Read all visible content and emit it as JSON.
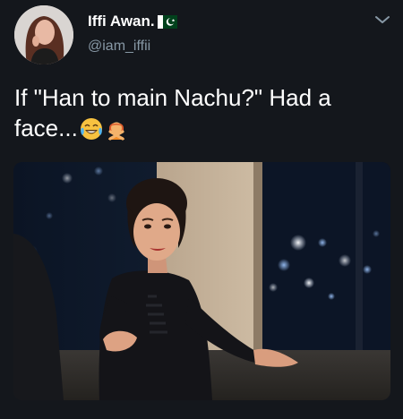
{
  "author": {
    "display_name": "Iffi Awan.",
    "handle": "@iam_iffii",
    "flag_icon": "pakistan-flag-icon"
  },
  "tweet": {
    "text": "If \"Han to main Nachu?\" Had a face...",
    "emojis": [
      "face-with-tears-of-joy-icon",
      "person-gesturing-no-icon"
    ]
  },
  "media": {
    "subject": "woman-shrugging-photo"
  },
  "colors": {
    "background": "#14171c",
    "handle": "#8899a6",
    "text": "#ffffff"
  }
}
